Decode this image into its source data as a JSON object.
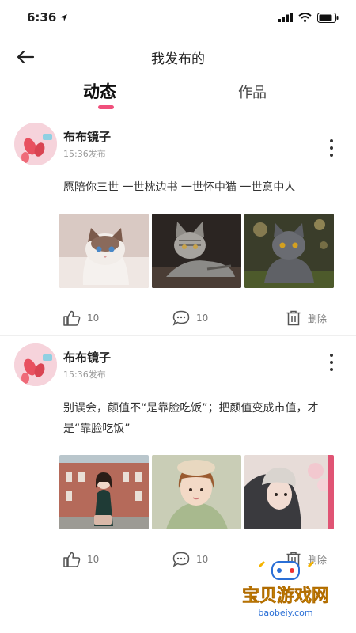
{
  "status": {
    "time": "6:36"
  },
  "nav": {
    "title": "我发布的"
  },
  "tabs": [
    {
      "label": "动态"
    },
    {
      "label": "作品"
    }
  ],
  "posts": [
    {
      "author": "布布镜子",
      "time": "15:36发布",
      "text": "愿陪你三世 一世枕边书 一世怀中猫 一世意中人",
      "images": [
        "ragdoll-cat-photo",
        "tabby-cat-photo",
        "gray-cat-photo"
      ],
      "likes": "10",
      "comments": "10",
      "delete_label": "删除"
    },
    {
      "author": "布布镜子",
      "time": "15:36发布",
      "text": "别误会，颜值不“是靠脸吃饭”；把颜值变成市值，才是“靠脸吃饭”",
      "images": [
        "girl-by-building-photo",
        "girl-with-hat-photo",
        "girl-with-cap-photo"
      ],
      "likes": "10",
      "comments": "10",
      "delete_label": "删除"
    }
  ],
  "watermark": {
    "brand": "宝贝游戏网",
    "url": "baobeiy.com"
  },
  "colors": {
    "accent": "#f0507c"
  }
}
